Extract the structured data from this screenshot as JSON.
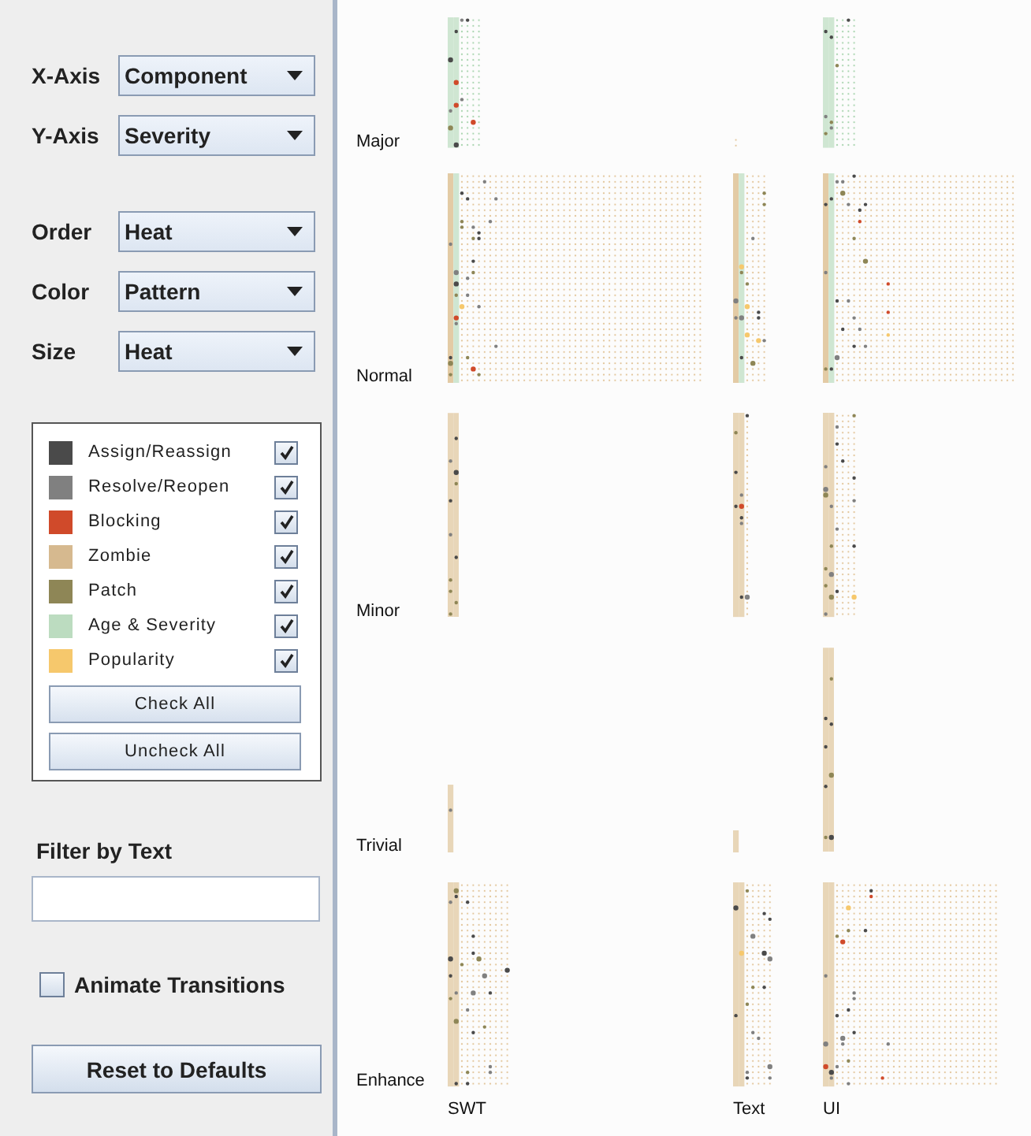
{
  "axes": [
    {
      "label": "X-Axis",
      "value": "Component"
    },
    {
      "label": "Y-Axis",
      "value": "Severity"
    }
  ],
  "options": [
    {
      "label": "Order",
      "value": "Heat"
    },
    {
      "label": "Color",
      "value": "Pattern"
    },
    {
      "label": "Size",
      "value": "Heat"
    }
  ],
  "legend": {
    "items": [
      {
        "name": "Assign/Reassign",
        "color": "#4a4a4a",
        "checked": true
      },
      {
        "name": "Resolve/Reopen",
        "color": "#808080",
        "checked": true
      },
      {
        "name": "Blocking",
        "color": "#d04a2a",
        "checked": true
      },
      {
        "name": "Zombie",
        "color": "#d6b98f",
        "checked": true
      },
      {
        "name": "Patch",
        "color": "#8e8656",
        "checked": true
      },
      {
        "name": "Age & Severity",
        "color": "#bcdcc0",
        "checked": true
      },
      {
        "name": "Popularity",
        "color": "#f6c86c",
        "checked": true
      }
    ],
    "buttons": [
      "Check All",
      "Uncheck All"
    ]
  },
  "filter": {
    "label": "Filter by Text"
  },
  "animate": {
    "label": "Animate Transitions",
    "checked": false
  },
  "reset_button": "Reset to Defaults",
  "matrix": {
    "rows": [
      "Major",
      "Normal",
      "Minor",
      "Trivial",
      "Enhance"
    ],
    "columns": [
      "SWT",
      "Text",
      "UI"
    ]
  }
}
